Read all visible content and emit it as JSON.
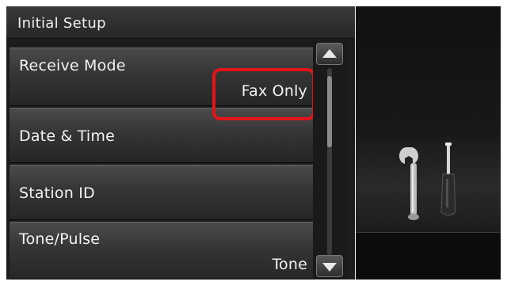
{
  "screen": {
    "title": "Initial Setup"
  },
  "menu": {
    "items": [
      {
        "label": "Receive Mode",
        "value": "Fax Only"
      },
      {
        "label": "Date & Time",
        "value": ""
      },
      {
        "label": "Station ID",
        "value": ""
      },
      {
        "label": "Tone/Pulse",
        "value": "Tone"
      }
    ]
  },
  "scroll": {
    "up_icon": "triangle-up-icon",
    "down_icon": "triangle-down-icon"
  },
  "side_tile": {
    "icon": "wrench-and-screwdriver-icon"
  },
  "colors": {
    "highlight": "#e5141b",
    "panel_bg": "#1c1c1c"
  }
}
